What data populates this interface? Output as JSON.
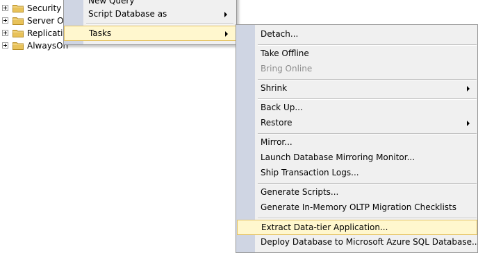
{
  "tree": {
    "items": [
      {
        "label": "Security"
      },
      {
        "label": "Server Ob"
      },
      {
        "label": "Replicatio"
      },
      {
        "label": "AlwaysOn"
      }
    ]
  },
  "parent_menu": {
    "items": [
      {
        "label": "New Query"
      },
      {
        "label": "Script Database as"
      },
      {
        "label": "Tasks"
      }
    ]
  },
  "tasks_menu": {
    "items": [
      {
        "label": "Detach..."
      },
      {
        "label": "Take Offline"
      },
      {
        "label": "Bring Online",
        "disabled": true
      },
      {
        "label": "Shrink"
      },
      {
        "label": "Back Up..."
      },
      {
        "label": "Restore"
      },
      {
        "label": "Mirror..."
      },
      {
        "label": "Launch Database Mirroring Monitor..."
      },
      {
        "label": "Ship Transaction Logs..."
      },
      {
        "label": "Generate Scripts..."
      },
      {
        "label": "Generate In-Memory OLTP Migration Checklists"
      },
      {
        "label": "Extract Data-tier Application..."
      },
      {
        "label": "Deploy Database to Microsoft Azure SQL Database..."
      }
    ]
  },
  "colors": {
    "highlight_bg": "#fff7ce",
    "highlight_border": "#e5c365",
    "menu_bg": "#f0f0f0",
    "gutter": "#cfd5e3",
    "folder": "#e8c25a"
  },
  "icons": [
    "expand-plus-icon",
    "folder-icon",
    "submenu-arrow-icon"
  ]
}
